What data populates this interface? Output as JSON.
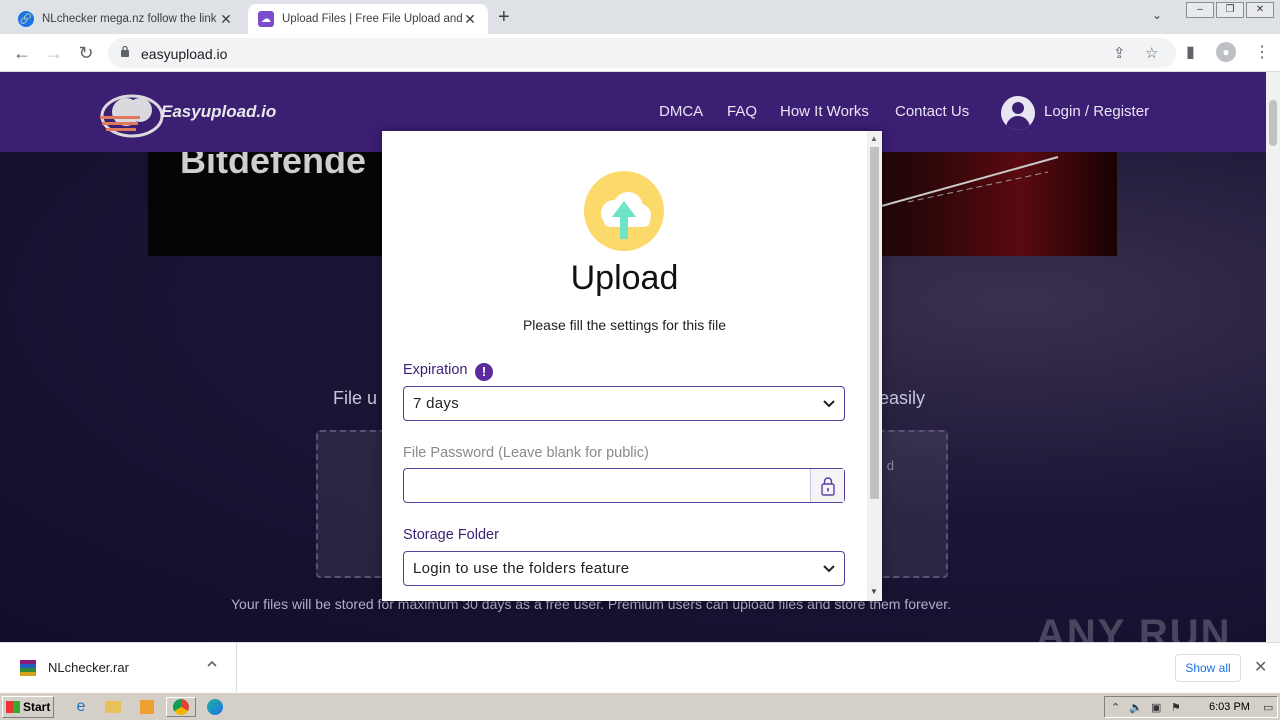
{
  "browser": {
    "tabs": [
      {
        "title": "NLchecker mega.nz follow the link —",
        "close": "✕"
      },
      {
        "title": "Upload Files | Free File Upload and T",
        "close": "✕"
      }
    ],
    "new_tab": "+",
    "url": "easyupload.io"
  },
  "site": {
    "logo": "Easyupload.io",
    "nav": [
      "DMCA",
      "FAQ",
      "How It Works",
      "Contact Us",
      "Login / Register"
    ],
    "banner_text": "Bitdefende",
    "hero_left": "File u",
    "hero_right": "easily",
    "dropzone_hint": "d",
    "footnote": "Your files will be stored for maximum 30 days as a free user. Premium users can upload files and store them forever.",
    "watermark": "ANY RUN"
  },
  "modal": {
    "title": "Upload",
    "subtitle": "Please fill the settings for this file",
    "expiration_label": "Expiration",
    "expiration_value": "7 days",
    "password_label": "File Password (Leave blank for public)",
    "password_value": "",
    "folder_label": "Storage Folder",
    "folder_value": "Login to use the folders feature"
  },
  "downloads": {
    "file": "NLchecker.rar",
    "show_all": "Show all"
  },
  "taskbar": {
    "start": "Start",
    "time": "6:03 PM"
  },
  "colors": {
    "nav_bg": "#3b1f73",
    "accent": "#5b3fa0",
    "upload_icon_bg": "#fbd96a",
    "upload_arrow": "#6fe3c8"
  }
}
